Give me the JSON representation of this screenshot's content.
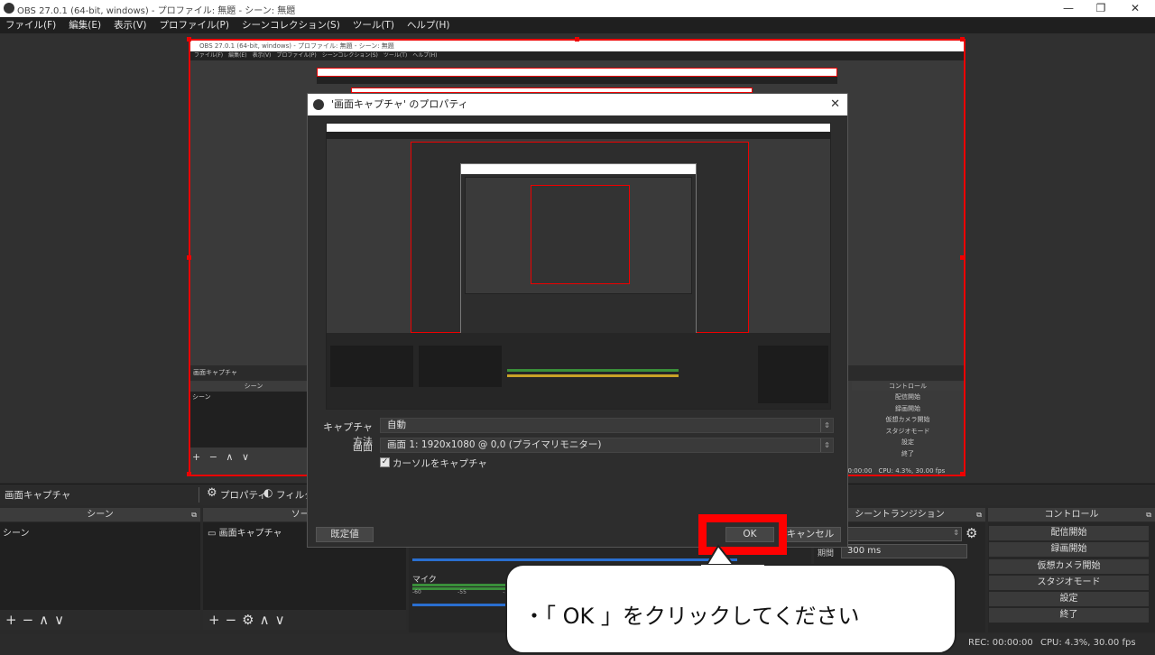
{
  "window": {
    "title": "OBS 27.0.1 (64-bit, windows) - プロファイル: 無題 - シーン: 無題",
    "minimize": "—",
    "restore": "❐",
    "close": "✕"
  },
  "menu": [
    "ファイル(F)",
    "編集(E)",
    "表示(V)",
    "プロファイル(P)",
    "シーンコレクション(S)",
    "ツール(T)",
    "ヘルプ(H)"
  ],
  "nested": {
    "title": "OBS 27.0.1 (64-bit, windows) - プロファイル: 無題 - シーン: 無題",
    "menu": "ファイル(F)　編集(E)　表示(V)　プロファイル(P)　シーンコレクション(S)　ツール(T)　ヘルプ(H)",
    "source_label": "画面キャプチャ",
    "scenes_header": "シーン",
    "scene_item": "シーン",
    "footer_controls": "+ − ∧ ∨",
    "control_header": "コントロール",
    "controls": [
      "配信開始",
      "録画開始",
      "仮想カメラ開始",
      "スタジオモード",
      "設定",
      "終了"
    ],
    "status": "00:00:00　CPU: 4.3%, 30.00 fps"
  },
  "toolbar": {
    "source_name": "画面キャプチャ",
    "properties": "プロパティ",
    "filters": "フィルタ"
  },
  "docks": {
    "scenes": {
      "header": "シーン",
      "items": [
        "シーン"
      ]
    },
    "sources": {
      "header": "ソース",
      "items": [
        "画面キャプチャ"
      ]
    },
    "mixer": {
      "mic_label": "マイク",
      "scale": [
        "-60",
        "-55",
        "-50"
      ]
    },
    "transitions": {
      "header": "シーントランジション",
      "duration_label": "期間",
      "duration_value": "300 ms"
    },
    "controls": {
      "header": "コントロール",
      "buttons": [
        "配信開始",
        "録画開始",
        "仮想カメラ開始",
        "スタジオモード",
        "設定",
        "終了"
      ]
    }
  },
  "footer_icons": {
    "add": "+",
    "remove": "−",
    "settings": "⚙",
    "up": "∧",
    "down": "∨"
  },
  "status": {
    "rec": "REC: 00:00:00",
    "cpu": "CPU: 4.3%, 30.00 fps"
  },
  "dialog": {
    "title": "'画面キャプチャ' のプロパティ",
    "close": "✕",
    "capture_method_label": "キャプチャ方法",
    "capture_method_value": "自動",
    "screen_label": "画面",
    "screen_value": "画面 1: 1920x1080 @ 0,0 (プライマリモニター)",
    "cursor_label": "カーソルをキャプチャ",
    "cursor_checked": true,
    "defaults_button": "既定値",
    "ok_button": "OK",
    "cancel_button": "キャンセル"
  },
  "callout": {
    "text": "・「 OK 」をクリックしてください"
  },
  "colors": {
    "highlight": "#ff0000",
    "selection": "#e00000"
  }
}
